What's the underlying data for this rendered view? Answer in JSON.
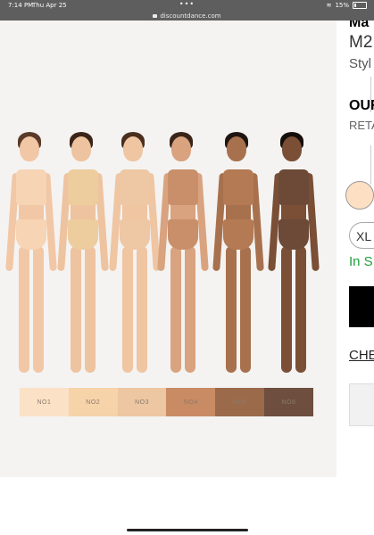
{
  "status_bar": {
    "time": "7:14 PM",
    "date": "Thu Apr 25",
    "battery": "15%"
  },
  "browser": {
    "url": "discountdance.com",
    "menu_dots": "•••"
  },
  "product": {
    "title_partial": "Ma",
    "code_partial": "M2",
    "style_partial": "Styl",
    "our_price_partial": "OUR",
    "retail_partial": "RETA",
    "size_partial": "XL",
    "stock_partial": "In S",
    "link_partial": "CHE"
  },
  "swatches": [
    {
      "label": "NO1",
      "color": "#fbe1c6"
    },
    {
      "label": "NO2",
      "color": "#f7d3aa"
    },
    {
      "label": "NO3",
      "color": "#edc7a2"
    },
    {
      "label": "NO4",
      "color": "#c98b63"
    },
    {
      "label": "NO5",
      "color": "#9b6a4b"
    },
    {
      "label": "NO6",
      "color": "#6e4e3e"
    }
  ],
  "models": [
    {
      "skin": "#f2c7a6",
      "garment": "#f6d4b4",
      "hair": "#5a3a28"
    },
    {
      "skin": "#eec39f",
      "garment": "#edcc9e",
      "hair": "#3a2418"
    },
    {
      "skin": "#efc5a2",
      "garment": "#eec7a4",
      "hair": "#4a2e1e"
    },
    {
      "skin": "#d9a37f",
      "garment": "#c98f6a",
      "hair": "#3a2418"
    },
    {
      "skin": "#a8714d",
      "garment": "#b47a54",
      "hair": "#1e1410"
    },
    {
      "skin": "#7a4f36",
      "garment": "#6c4a37",
      "hair": "#140d0a"
    }
  ]
}
